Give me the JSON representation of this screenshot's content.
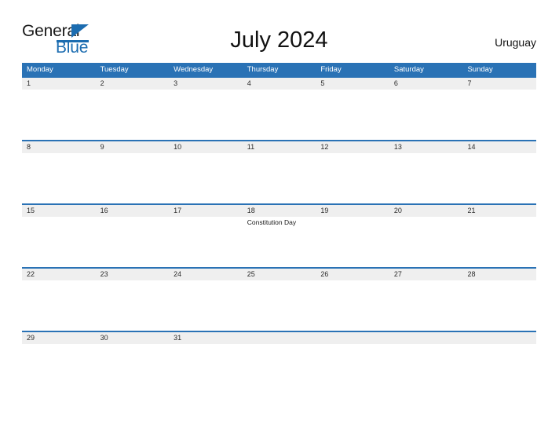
{
  "brand": {
    "name_primary": "General",
    "name_secondary": "Blue",
    "color_primary": "#1a1a1a",
    "color_secondary": "#1b6cb0"
  },
  "header": {
    "title": "July 2024",
    "region": "Uruguay"
  },
  "theme": {
    "header_blue": "#2a72b5",
    "band_gray": "#efefef",
    "page_background": "#ffffff",
    "text_dark": "#2b2b2b"
  },
  "calendar": {
    "weekday_headers": [
      "Monday",
      "Tuesday",
      "Wednesday",
      "Thursday",
      "Friday",
      "Saturday",
      "Sunday"
    ],
    "weeks": [
      {
        "days": [
          {
            "date": "1",
            "event": ""
          },
          {
            "date": "2",
            "event": ""
          },
          {
            "date": "3",
            "event": ""
          },
          {
            "date": "4",
            "event": ""
          },
          {
            "date": "5",
            "event": ""
          },
          {
            "date": "6",
            "event": ""
          },
          {
            "date": "7",
            "event": ""
          }
        ]
      },
      {
        "days": [
          {
            "date": "8",
            "event": ""
          },
          {
            "date": "9",
            "event": ""
          },
          {
            "date": "10",
            "event": ""
          },
          {
            "date": "11",
            "event": ""
          },
          {
            "date": "12",
            "event": ""
          },
          {
            "date": "13",
            "event": ""
          },
          {
            "date": "14",
            "event": ""
          }
        ]
      },
      {
        "days": [
          {
            "date": "15",
            "event": ""
          },
          {
            "date": "16",
            "event": ""
          },
          {
            "date": "17",
            "event": ""
          },
          {
            "date": "18",
            "event": "Constitution Day"
          },
          {
            "date": "19",
            "event": ""
          },
          {
            "date": "20",
            "event": ""
          },
          {
            "date": "21",
            "event": ""
          }
        ]
      },
      {
        "days": [
          {
            "date": "22",
            "event": ""
          },
          {
            "date": "23",
            "event": ""
          },
          {
            "date": "24",
            "event": ""
          },
          {
            "date": "25",
            "event": ""
          },
          {
            "date": "26",
            "event": ""
          },
          {
            "date": "27",
            "event": ""
          },
          {
            "date": "28",
            "event": ""
          }
        ]
      },
      {
        "days": [
          {
            "date": "29",
            "event": ""
          },
          {
            "date": "30",
            "event": ""
          },
          {
            "date": "31",
            "event": ""
          },
          {
            "date": "",
            "event": ""
          },
          {
            "date": "",
            "event": ""
          },
          {
            "date": "",
            "event": ""
          },
          {
            "date": "",
            "event": ""
          }
        ]
      }
    ]
  }
}
